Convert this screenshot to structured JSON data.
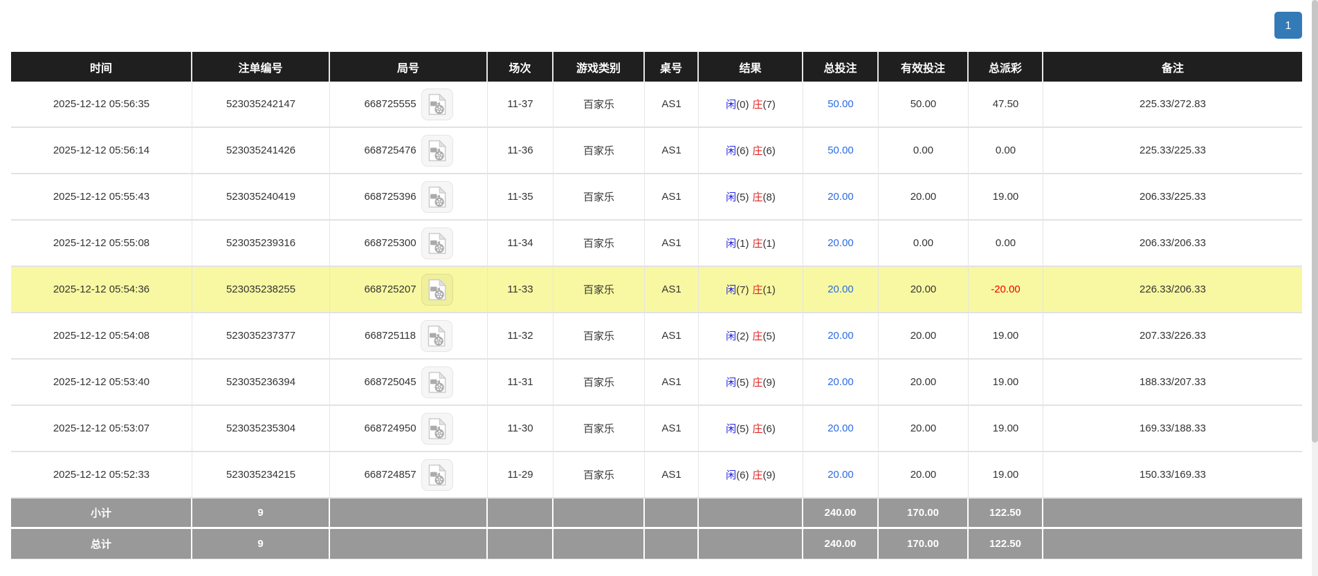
{
  "pagination": {
    "pages": [
      "1"
    ]
  },
  "colors": {
    "header_bg": "#1f1f1f",
    "summary_bg": "#999999",
    "highlight_row_bg": "#f8f8a2",
    "pagination_active": "#337ab7",
    "player_blue": "#2222dd",
    "banker_red": "#dd2222",
    "bet_link_blue": "#2a6be0",
    "negative_red": "#ee0000"
  },
  "icons": {
    "video_icon": "video-file-icon"
  },
  "table": {
    "columns": [
      "时间",
      "注单编号",
      "局号",
      "场次",
      "游戏类别",
      "桌号",
      "结果",
      "总投注",
      "有效投注",
      "总派彩",
      "备注"
    ],
    "rows": [
      {
        "time": "2025-12-12 05:56:35",
        "bet_id": "523035242147",
        "game_no": "668725555",
        "session": "11-37",
        "game_type": "百家乐",
        "table_no": "AS1",
        "player_label": "闲",
        "player_val": "(0)",
        "banker_label": "庄",
        "banker_val": "(7)",
        "total_bet": "50.00",
        "valid_bet": "50.00",
        "payout": "47.50",
        "remark": "225.33/272.83",
        "highlight": false
      },
      {
        "time": "2025-12-12 05:56:14",
        "bet_id": "523035241426",
        "game_no": "668725476",
        "session": "11-36",
        "game_type": "百家乐",
        "table_no": "AS1",
        "player_label": "闲",
        "player_val": "(6)",
        "banker_label": "庄",
        "banker_val": "(6)",
        "total_bet": "50.00",
        "valid_bet": "0.00",
        "payout": "0.00",
        "remark": "225.33/225.33",
        "highlight": false
      },
      {
        "time": "2025-12-12 05:55:43",
        "bet_id": "523035240419",
        "game_no": "668725396",
        "session": "11-35",
        "game_type": "百家乐",
        "table_no": "AS1",
        "player_label": "闲",
        "player_val": "(5)",
        "banker_label": "庄",
        "banker_val": "(8)",
        "total_bet": "20.00",
        "valid_bet": "20.00",
        "payout": "19.00",
        "remark": "206.33/225.33",
        "highlight": false
      },
      {
        "time": "2025-12-12 05:55:08",
        "bet_id": "523035239316",
        "game_no": "668725300",
        "session": "11-34",
        "game_type": "百家乐",
        "table_no": "AS1",
        "player_label": "闲",
        "player_val": "(1)",
        "banker_label": "庄",
        "banker_val": "(1)",
        "total_bet": "20.00",
        "valid_bet": "0.00",
        "payout": "0.00",
        "remark": "206.33/206.33",
        "highlight": false
      },
      {
        "time": "2025-12-12 05:54:36",
        "bet_id": "523035238255",
        "game_no": "668725207",
        "session": "11-33",
        "game_type": "百家乐",
        "table_no": "AS1",
        "player_label": "闲",
        "player_val": "(7)",
        "banker_label": "庄",
        "banker_val": "(1)",
        "total_bet": "20.00",
        "valid_bet": "20.00",
        "payout": "-20.00",
        "remark": "226.33/206.33",
        "highlight": true
      },
      {
        "time": "2025-12-12 05:54:08",
        "bet_id": "523035237377",
        "game_no": "668725118",
        "session": "11-32",
        "game_type": "百家乐",
        "table_no": "AS1",
        "player_label": "闲",
        "player_val": "(2)",
        "banker_label": "庄",
        "banker_val": "(5)",
        "total_bet": "20.00",
        "valid_bet": "20.00",
        "payout": "19.00",
        "remark": "207.33/226.33",
        "highlight": false
      },
      {
        "time": "2025-12-12 05:53:40",
        "bet_id": "523035236394",
        "game_no": "668725045",
        "session": "11-31",
        "game_type": "百家乐",
        "table_no": "AS1",
        "player_label": "闲",
        "player_val": "(5)",
        "banker_label": "庄",
        "banker_val": "(9)",
        "total_bet": "20.00",
        "valid_bet": "20.00",
        "payout": "19.00",
        "remark": "188.33/207.33",
        "highlight": false
      },
      {
        "time": "2025-12-12 05:53:07",
        "bet_id": "523035235304",
        "game_no": "668724950",
        "session": "11-30",
        "game_type": "百家乐",
        "table_no": "AS1",
        "player_label": "闲",
        "player_val": "(5)",
        "banker_label": "庄",
        "banker_val": "(6)",
        "total_bet": "20.00",
        "valid_bet": "20.00",
        "payout": "19.00",
        "remark": "169.33/188.33",
        "highlight": false
      },
      {
        "time": "2025-12-12 05:52:33",
        "bet_id": "523035234215",
        "game_no": "668724857",
        "session": "11-29",
        "game_type": "百家乐",
        "table_no": "AS1",
        "player_label": "闲",
        "player_val": "(6)",
        "banker_label": "庄",
        "banker_val": "(9)",
        "total_bet": "20.00",
        "valid_bet": "20.00",
        "payout": "19.00",
        "remark": "150.33/169.33",
        "highlight": false
      }
    ],
    "summary": [
      {
        "label": "小计",
        "count": "9",
        "total_bet": "240.00",
        "valid_bet": "170.00",
        "payout": "122.50"
      },
      {
        "label": "总计",
        "count": "9",
        "total_bet": "240.00",
        "valid_bet": "170.00",
        "payout": "122.50"
      }
    ]
  }
}
